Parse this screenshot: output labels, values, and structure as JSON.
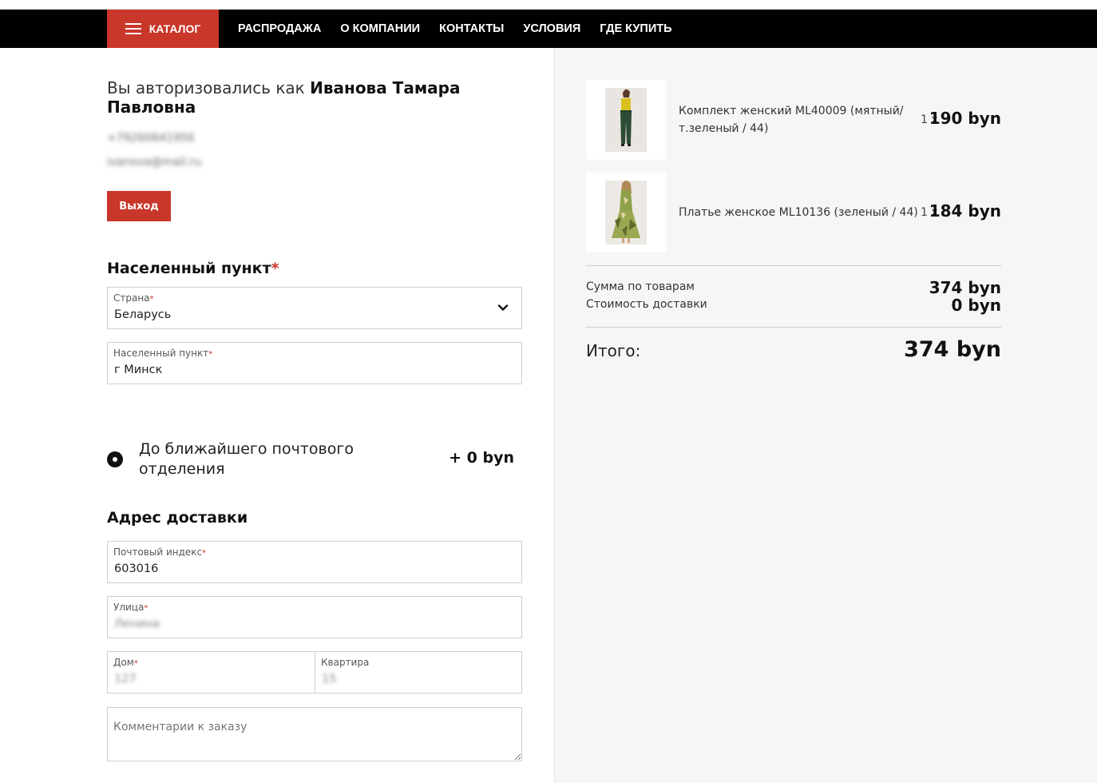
{
  "nav": {
    "catalog_label": "КАТАЛОГ",
    "links": [
      "РАСПРОДАЖА",
      "О КОМПАНИИ",
      "КОНТАКТЫ",
      "УСЛОВИЯ",
      "ГДЕ КУПИТЬ"
    ]
  },
  "user": {
    "auth_prefix": "Вы авторизовались как ",
    "name": "Иванова Тамара Павловна",
    "phone": "+79260641956",
    "email": "ivanova@mail.ru",
    "logout_label": "Выход"
  },
  "location": {
    "title": "Населенный пункт",
    "required_mark": "*",
    "country_label": "Страна",
    "country_value": "Беларусь",
    "city_label": "Населенный пункт",
    "city_value": "г Минск"
  },
  "delivery": {
    "option_label": "До ближайшего почтового отделения",
    "option_price": "+ 0 byn"
  },
  "address": {
    "title": "Адрес доставки",
    "postal_label": "Почтовый индекс",
    "postal_value": "603016",
    "street_label": "Улица",
    "street_value": "Ленина",
    "house_label": "Дом",
    "house_value": "127",
    "apartment_label": "Квартира",
    "apartment_value": "15",
    "comment_placeholder": "Комментарии к заказу"
  },
  "cart": {
    "items": [
      {
        "name": "Комплект женский ML40009 (мятный/т.зеленый / 44)",
        "qty": "1 x",
        "price": "190 byn",
        "image": "woman-yellow-top-green-pants"
      },
      {
        "name": "Платье женское ML10136 (зеленый / 44)",
        "qty": "1 x",
        "price": "184 byn",
        "image": "woman-green-floral-dress"
      }
    ],
    "subtotal_label": "Сумма по товарам",
    "subtotal_value": "374 byn",
    "shipping_label": "Стоимость доставки",
    "shipping_value": "0 byn",
    "total_label": "Итого:",
    "total_value": "374 byn"
  },
  "colors": {
    "accent": "#c9362a",
    "navbar": "#000000",
    "panel": "#f5f6f8"
  }
}
